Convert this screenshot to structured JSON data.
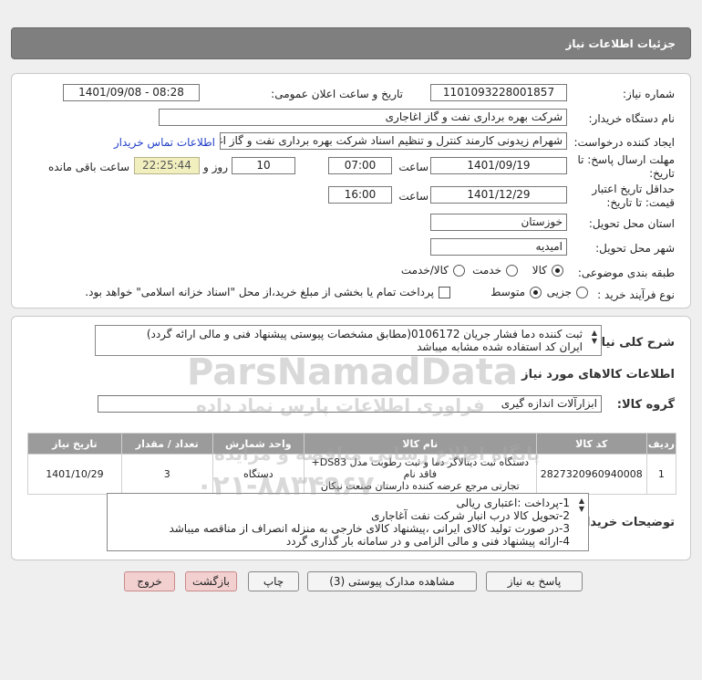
{
  "header": {
    "title": "جزئیات اطلاعات نیاز"
  },
  "form": {
    "need_number_label": "شماره نیاز:",
    "need_number": "1101093228001857",
    "announce_label": "تاریخ و ساعت اعلان عمومی:",
    "announce_value": "1401/09/08 - 08:28",
    "buyer_label": "نام دستگاه خریدار:",
    "buyer_value": "شرکت بهره برداری نفت و گاز اغاجاری",
    "creator_label": "ایجاد کننده درخواست:",
    "creator_value": "شهرام زیدونی کارمند کنترل و تنظیم اسناد شرکت بهره برداری نفت و گاز اغاجاری",
    "contact_link": "اطلاعات تماس خریدار",
    "deadline_label_1": "مهلت ارسال پاسخ: تا",
    "deadline_label_2": "تاریخ:",
    "deadline_date": "1401/09/19",
    "time_label": "ساعت",
    "deadline_time": "07:00",
    "days_value": "10",
    "days_label": "روز و",
    "remaining_time": "22:25:44",
    "remaining_label": "ساعت باقی مانده",
    "validity_label_1": "حداقل تاریخ اعتبار",
    "validity_label_2": "قیمت: تا تاریخ:",
    "validity_date": "1401/12/29",
    "validity_time_label": "ساعت",
    "validity_time": "16:00",
    "province_label": "استان محل تحویل:",
    "province_value": "خوزستان",
    "city_label": "شهر محل تحویل:",
    "city_value": "امیدیه",
    "category_label": "طبقه بندی موضوعی:",
    "category_options": [
      "کالا",
      "خدمت",
      "کالا/خدمت"
    ],
    "process_label": "نوع فرآیند خرید :",
    "process_options": [
      "جزیی",
      "متوسط"
    ],
    "process_note": "پرداخت تمام یا بخشی از مبلغ خرید،از محل \"اسناد خزانه اسلامی\" خواهد بود."
  },
  "description": {
    "label": "شرح کلی نیاز:",
    "line1": "ثبت کننده دما فشار جریان 0106172(مطابق مشخصات پیوستی پیشنهاد فنی و مالی ارائه گردد)",
    "line2": "ایران کد استفاده شده مشابه میباشد"
  },
  "goods_section": {
    "title": "اطلاعات کالاهای مورد نیاز",
    "group_label": "گروه کالا:",
    "group_value": "ابزارآلات اندازه گیری"
  },
  "table": {
    "headers": [
      "ردیف",
      "کد کالا",
      "نام کالا",
      "واحد شمارش",
      "تعداد / مقدار",
      "تاریخ نیاز"
    ],
    "rows": [
      {
        "row": "1",
        "code": "2827320960940008",
        "name_line1": "دستگاه ثبت دیتالاگر دما و ثبت رطوبت مدل DS83+ فاقد نام",
        "name_line2": "تجارتی مرجع عرضه کننده دارستان صنعت نیکان",
        "unit": "دستگاه",
        "qty": "3",
        "date": "1401/10/29"
      }
    ]
  },
  "buyer_notes": {
    "label": "توضیحات خریدار:",
    "lines": [
      "1-پرداخت :اعتباری ریالی",
      "2-تحویل کالا درب انبار شرکت نفت آغاجاری",
      "3-در صورت تولید کالای ایرانی ،پیشنهاد کالای خارجی به منزله انصراف از مناقصه میباشد",
      "4-ارائه پیشنهاد فنی و مالی الزامی و در سامانه بار گذاری گردد"
    ]
  },
  "buttons": {
    "reply": "پاسخ به نیاز",
    "docs": "مشاهده مدارک پیوستی (3)",
    "print": "چاپ",
    "back": "بازگشت",
    "exit": "خروج"
  },
  "watermark": {
    "brand": "ParsNamadData",
    "fa1": "پایگاه اطلاع رسانی مناقصه و مزایده",
    "fa2": "فراوری اطلاعات پارس نماد داده",
    "phone": "۰۲۱-۸۸۳۴۹۶۷۰"
  }
}
